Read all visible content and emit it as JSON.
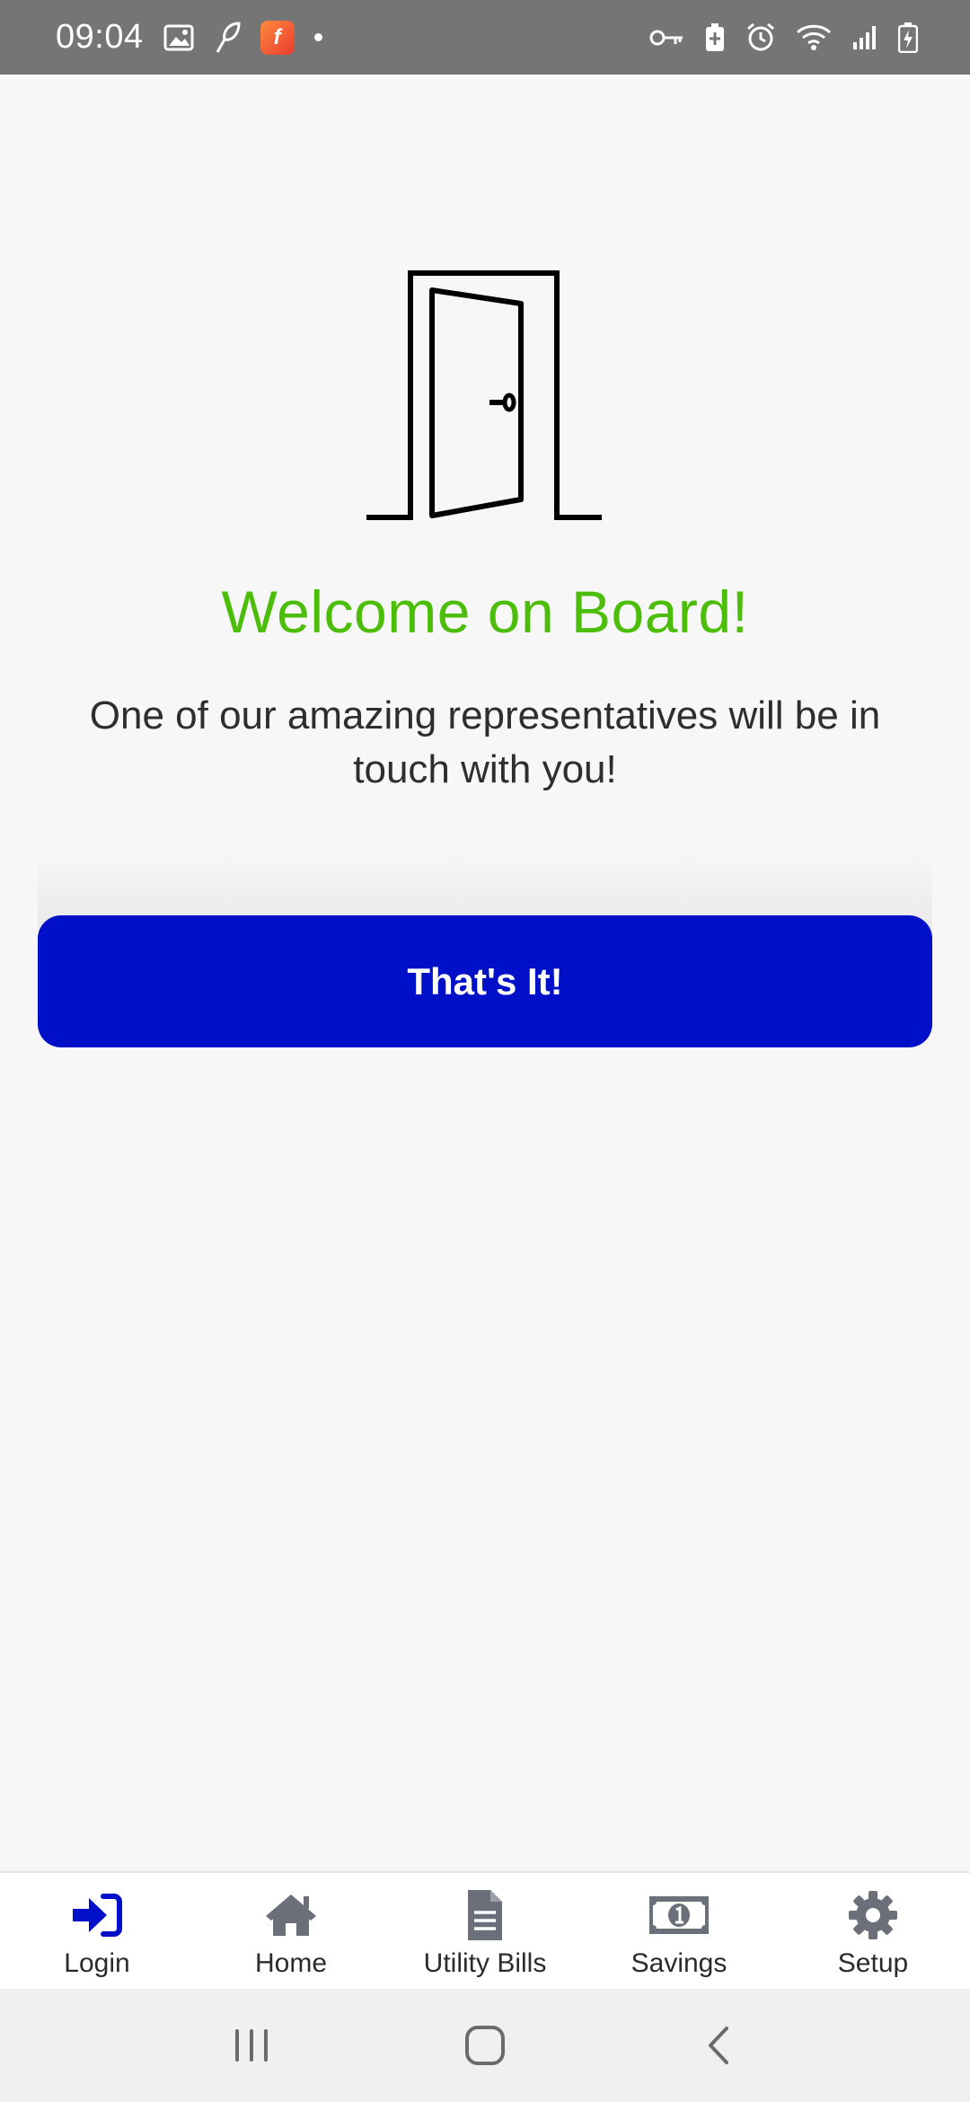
{
  "status_bar": {
    "time": "09:04",
    "left_icons": [
      "gallery-icon",
      "feather-icon",
      "app-badge-icon",
      "dot-icon"
    ],
    "app_badge_letter": "f",
    "right_icons": [
      "vpn-key-icon",
      "battery-saver-icon",
      "alarm-icon",
      "wifi-icon",
      "signal-icon",
      "battery-icon"
    ]
  },
  "main": {
    "illustration": "open-door-icon",
    "title": "Welcome on Board!",
    "subtitle": "One of our amazing representatives will be in touch with you!",
    "button_label": "That's It!"
  },
  "bottom_nav": {
    "items": [
      {
        "label": "Login",
        "icon": "login-icon",
        "active": true
      },
      {
        "label": "Home",
        "icon": "home-icon",
        "active": false
      },
      {
        "label": "Utility Bills",
        "icon": "document-icon",
        "active": false
      },
      {
        "label": "Savings",
        "icon": "money-bill-icon",
        "active": false
      },
      {
        "label": "Setup",
        "icon": "gear-icon",
        "active": false
      }
    ]
  },
  "system_nav": [
    "recent-apps-icon",
    "home-button-icon",
    "back-icon"
  ],
  "colors": {
    "accent_green": "#4cbe0a",
    "button_blue": "#0010c8",
    "nav_active": "#0010c8",
    "nav_inactive": "#6b6f7a",
    "status_bar": "#757575",
    "background": "#f7f7f7"
  }
}
